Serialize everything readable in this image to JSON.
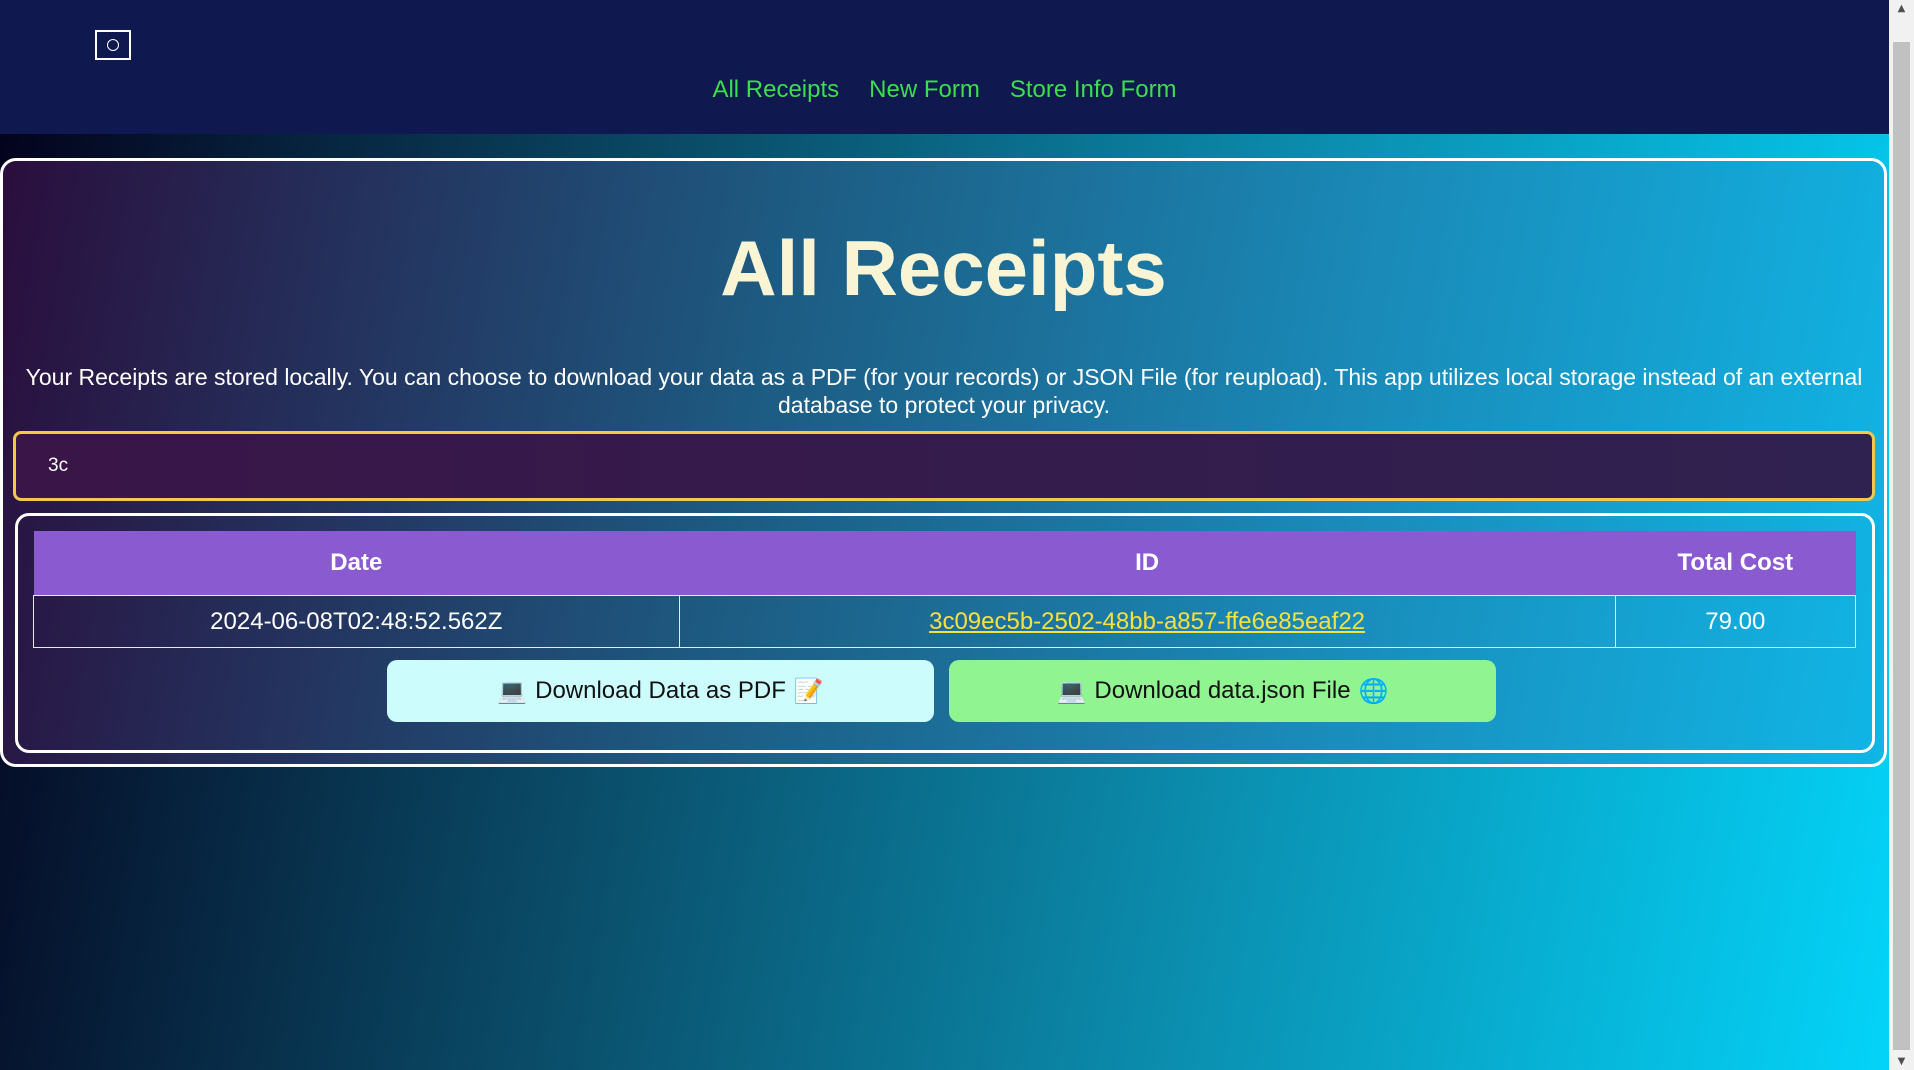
{
  "header": {
    "logo_icon": "camera-icon",
    "nav": [
      {
        "label": "All Receipts"
      },
      {
        "label": "New Form"
      },
      {
        "label": "Store Info Form"
      }
    ],
    "nav_color": "#3adf4a"
  },
  "main": {
    "title": "All Receipts",
    "intro": "Your Receipts are stored locally. You can choose to download your data as a PDF (for your records) or JSON File (for reupload). This app utilizes local storage instead of an external database to protect your privacy.",
    "search": {
      "value": "3c",
      "placeholder": ""
    },
    "table": {
      "columns": [
        "Date",
        "ID",
        "Total Cost"
      ],
      "rows": [
        {
          "date": "2024-06-08T02:48:52.562Z",
          "id": "3c09ec5b-2502-48bb-a857-ffe6e85eaf22",
          "total": "79.00"
        }
      ]
    },
    "buttons": {
      "pdf": {
        "label": "Download Data as PDF",
        "icon_left": "💻",
        "icon_right": "📝",
        "color": "#ccfcfc"
      },
      "json": {
        "label": "Download data.json File",
        "icon_left": "💻",
        "icon_right": "🌐",
        "color": "#90f591"
      }
    }
  },
  "colors": {
    "title": "#f8f4d4",
    "table_header": "#8a5bd0",
    "link": "#f7e23b",
    "search_border": "#f2c94c"
  }
}
